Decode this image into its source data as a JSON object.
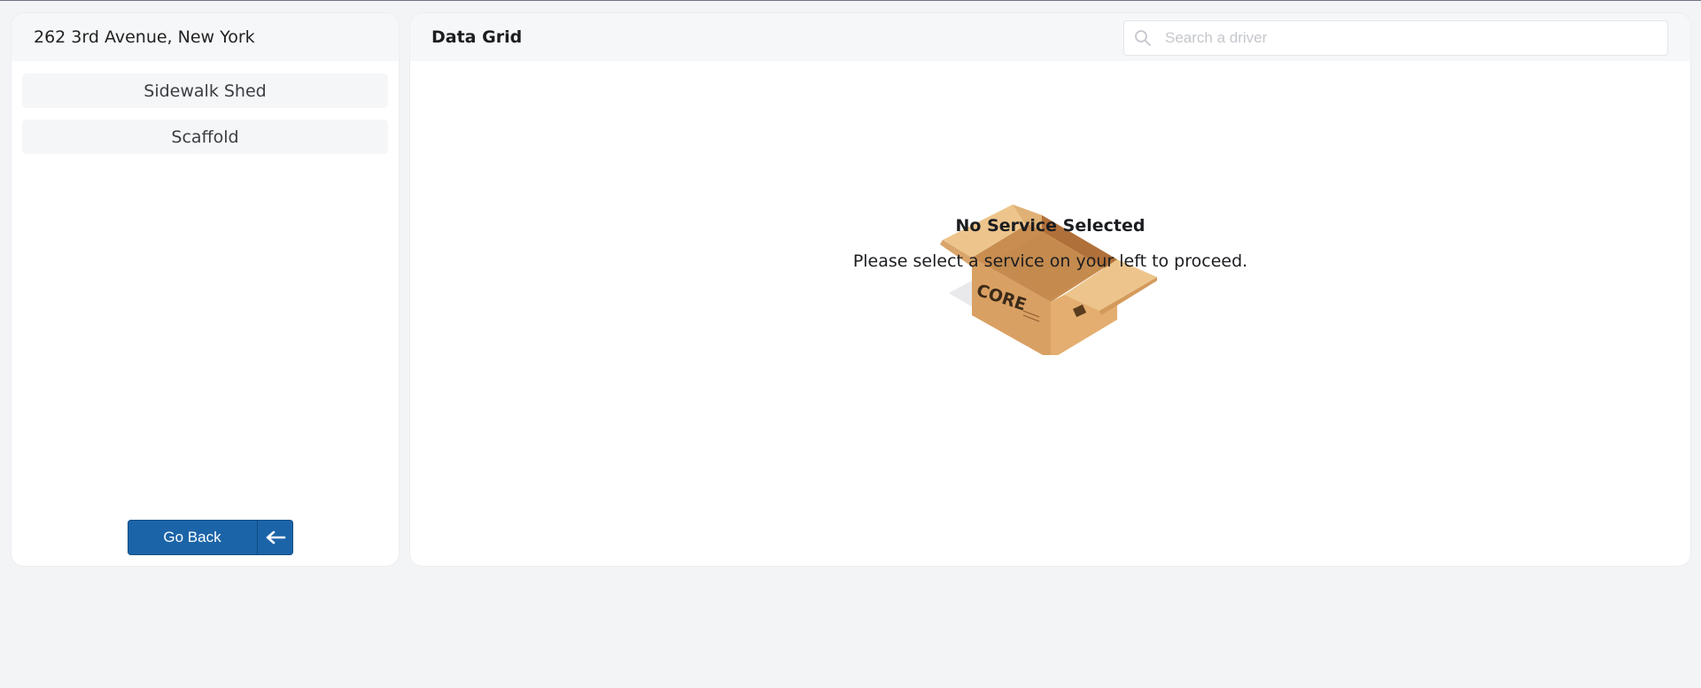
{
  "sidebar": {
    "address": "262 3rd Avenue, New York",
    "services": [
      {
        "label": "Sidewalk Shed"
      },
      {
        "label": "Scaffold"
      }
    ],
    "go_back_label": "Go Back",
    "go_back_icon": "arrow-left-icon"
  },
  "main": {
    "title": "Data Grid",
    "search": {
      "placeholder": "Search a driver",
      "value": "",
      "icon": "search-icon"
    },
    "empty_state": {
      "title": "No Service Selected",
      "message": "Please select a service on your left to proceed.",
      "illustration": "open-box-illustration",
      "box_text": "CORE"
    }
  },
  "colors": {
    "background": "#f3f4f6",
    "panel": "#ffffff",
    "header": "#f6f7f9",
    "primary_button": "#1b64a8",
    "box_light": "#e8bb7c",
    "box_mid": "#d9a063",
    "box_dark": "#b0703a"
  }
}
